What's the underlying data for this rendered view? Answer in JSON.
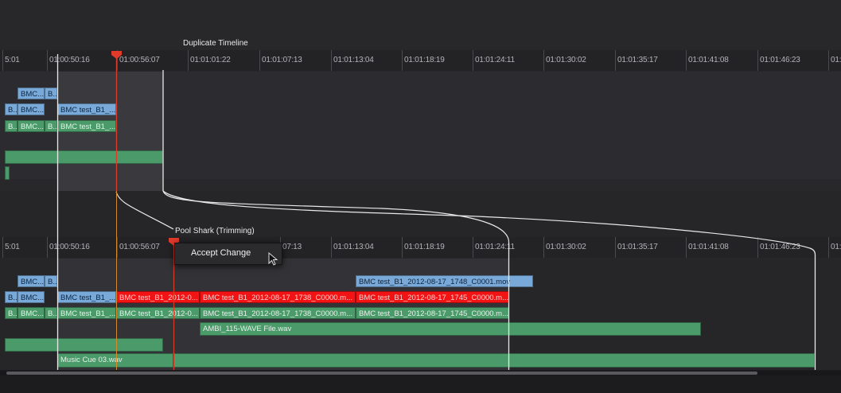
{
  "top_timeline": {
    "title": "Duplicate Timeline",
    "ticks": [
      "5:01",
      "01:00:50:16",
      "01:00:56:07",
      "01:01:01:22",
      "01:01:07:13",
      "01:01:13:04",
      "01:01:18:19",
      "01:01:24:11",
      "01:01:30:02",
      "01:01:35:17",
      "01:01:41:08",
      "01:01:46:23",
      "01:"
    ],
    "clips": {
      "v1a": "BMC...",
      "v1b": "B...",
      "v2a": "B...",
      "v2b": "BMC...",
      "v2c": "BMC test_B1_...",
      "a1a": "B...",
      "a1b": "BMC...",
      "a1c": "B...",
      "a1d": "BMC test_B1_..."
    }
  },
  "bottom_timeline": {
    "title": "Pool Shark (Trimming)",
    "ticks": [
      "5:01",
      "01:00:50:16",
      "01:00:56:07",
      "07:13",
      "01:01:13:04",
      "01:01:18:19",
      "01:01:24:11",
      "01:01:30:02",
      "01:01:35:17",
      "01:01:41:08",
      "01:01:46:23",
      "01:"
    ],
    "clips": {
      "v1a": "BMC...",
      "v1b": "B...",
      "v1_mov": "BMC test_B1_2012-08-17_1748_C0001.mov",
      "v2a": "B...",
      "v2b": "BMC...",
      "v2c": "BMC test_B1_...",
      "r1": "BMC test_B1_2012-0...",
      "r2": "BMC test_B1_2012-08-17_1738_C0000.m...",
      "r3": "BMC test_B1_2012-08-17_1745_C0000.m...",
      "a1a": "B...",
      "a1b": "BMC...",
      "a1c": "B...",
      "a1d": "BMC test_B1_...",
      "g1": "BMC test_B1_2012-0...",
      "g2": "BMC test_B1_2012-08-17_1738_C0000.m...",
      "g3": "BMC test_B1_2012-08-17_1745_C0000.m...",
      "ambi": "AMBI_115-WAVE File.wav",
      "music": "Music Cue 03.wav"
    }
  },
  "context_menu": {
    "accept": "Accept Change"
  },
  "colors": {
    "playhead": "#e03a2a",
    "video": "#79a9d8",
    "audio": "#4b9a6a",
    "trim": "#f21414"
  }
}
